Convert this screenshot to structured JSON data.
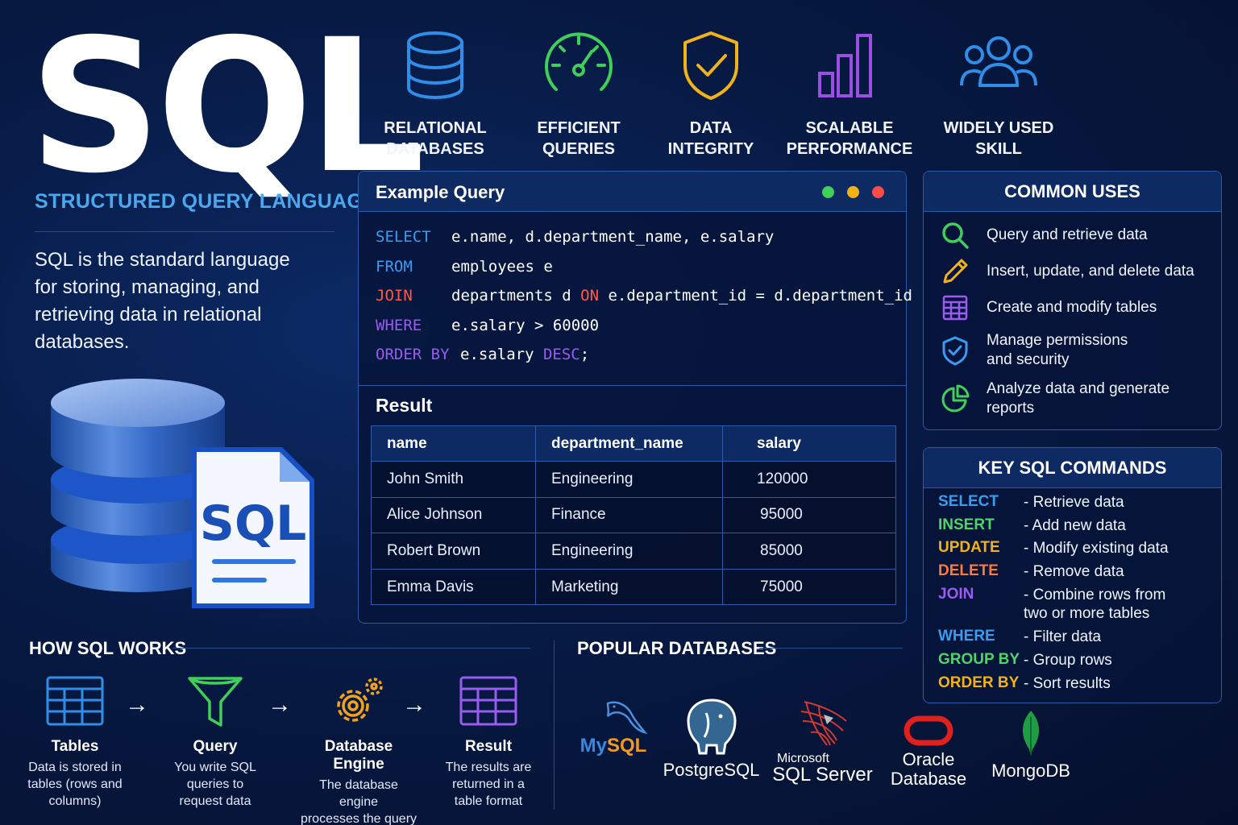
{
  "title": "SQL",
  "subtitle": "STRUCTURED QUERY LANGUAGE",
  "description": "SQL is the standard language for storing, managing, and retrieving data in relational databases.",
  "hero": {
    "badge": "SQL"
  },
  "features": [
    {
      "label": "RELATIONAL\nDATABASES",
      "icon": "database-icon",
      "color": "#2f8fe8"
    },
    {
      "label": "EFFICIENT\nQUERIES",
      "icon": "speedometer-icon",
      "color": "#3fcf5a"
    },
    {
      "label": "DATA\nINTEGRITY",
      "icon": "shield-check-icon",
      "color": "#f2b318"
    },
    {
      "label": "SCALABLE\nPERFORMANCE",
      "icon": "bar-chart-icon",
      "color": "#9a4fe0"
    },
    {
      "label": "WIDELY USED\nSKILL",
      "icon": "users-icon",
      "color": "#2f8fe8"
    }
  ],
  "example_query": {
    "title": "Example Query",
    "lines": [
      {
        "keyword": "SELECT",
        "color": "#3a9bef",
        "rest": "e.name, d.department_name, e.salary"
      },
      {
        "keyword": "FROM",
        "color": "#3a9bef",
        "rest": "employees e"
      },
      {
        "keyword": "JOIN",
        "color": "#ff5a45",
        "rest_pre": "departments d ",
        "inline_kw": "ON",
        "rest_post": " e.department_id = d.department_id"
      },
      {
        "keyword": "WHERE",
        "color": "#9a5cf0",
        "rest": "e.salary > 60000"
      },
      {
        "keyword": "ORDER BY",
        "color": "#9a5cf0",
        "rest_pre": "e.salary ",
        "inline_kw": "DESC",
        "rest_post": ";"
      }
    ],
    "result_title": "Result",
    "columns": [
      "name",
      "department_name",
      "salary"
    ],
    "rows": [
      [
        "John Smith",
        "Engineering",
        "120000"
      ],
      [
        "Alice Johnson",
        "Finance",
        "95000"
      ],
      [
        "Robert Brown",
        "Engineering",
        "85000"
      ],
      [
        "Emma Davis",
        "Marketing",
        "75000"
      ]
    ]
  },
  "common_uses": {
    "title": "COMMON USES",
    "items": [
      {
        "text": "Query and retrieve data",
        "icon": "search-icon"
      },
      {
        "text": "Insert, update, and delete data",
        "icon": "pencil-icon"
      },
      {
        "text": "Create and modify tables",
        "icon": "table-icon"
      },
      {
        "text": "Manage permissions\nand security",
        "icon": "shield-check-icon"
      },
      {
        "text": "Analyze data and generate\nreports",
        "icon": "pie-chart-icon"
      }
    ]
  },
  "key_commands": {
    "title": "KEY SQL COMMANDS",
    "items": [
      {
        "name": "SELECT",
        "desc": "- Retrieve data",
        "color": "#3a9bef"
      },
      {
        "name": "INSERT",
        "desc": "- Add new data",
        "color": "#4fd36a"
      },
      {
        "name": "UPDATE",
        "desc": "- Modify existing data",
        "color": "#f2b318"
      },
      {
        "name": "DELETE",
        "desc": "- Remove data",
        "color": "#ff7a3a"
      },
      {
        "name": "JOIN",
        "desc": "- Combine rows from\n  two or more tables",
        "color": "#9a5cf0"
      },
      {
        "name": "WHERE",
        "desc": "- Filter data",
        "color": "#3a9bef"
      },
      {
        "name": "GROUP BY",
        "desc": "- Group rows",
        "color": "#4fd36a"
      },
      {
        "name": "ORDER BY",
        "desc": "- Sort results",
        "color": "#f2b318"
      }
    ]
  },
  "how_sql_works": {
    "title": "HOW SQL WORKS",
    "steps": [
      {
        "name": "Tables",
        "desc": "Data is stored in\ntables (rows and\ncolumns)",
        "icon": "table-icon"
      },
      {
        "name": "Query",
        "desc": "You write SQL\nqueries to\nrequest data",
        "icon": "funnel-icon"
      },
      {
        "name": "Database Engine",
        "desc": "The database engine\nprocesses the query",
        "icon": "gears-icon"
      },
      {
        "name": "Result",
        "desc": "The results are\nreturned in a\ntable format",
        "icon": "result-table-icon"
      }
    ],
    "arrow": "→"
  },
  "popular_databases": {
    "title": "POPULAR DATABASES",
    "items": [
      {
        "name": "MySQL",
        "icon": "dolphin-icon"
      },
      {
        "name": "PostgreSQL",
        "icon": "elephant-icon"
      },
      {
        "name_small": "Microsoft",
        "name": "SQL Server",
        "icon": "sql-server-icon"
      },
      {
        "name": "Oracle\nDatabase",
        "icon": "oracle-icon"
      },
      {
        "name": "MongoDB",
        "icon": "leaf-icon"
      }
    ]
  }
}
